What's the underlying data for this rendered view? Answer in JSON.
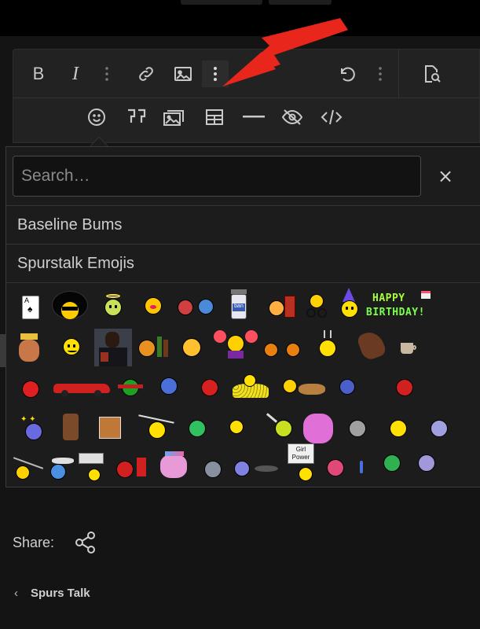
{
  "search": {
    "placeholder": "Search…"
  },
  "close_symbol": "×",
  "categories": [
    {
      "label": "Baseline Bums"
    },
    {
      "label": "Spurstalk Emojis"
    }
  ],
  "birthday_badge": {
    "line1": "HAPPY",
    "line2": "BIRTHDAY!"
  },
  "share": {
    "label": "Share:"
  },
  "breadcrumb": {
    "label": "Spurs Talk",
    "chevron": "‹"
  },
  "toolbar": {
    "row1_icons": [
      "bold-icon",
      "italic-icon",
      "more-vertical-icon",
      "link-icon",
      "image-icon",
      "more-vertical-icon",
      "undo-icon",
      "more-vertical-icon",
      "preview-icon"
    ],
    "row2_icons": [
      "smiley-icon",
      "quote-icon",
      "media-icon",
      "table-icon",
      "horizontal-rule-icon",
      "spoiler-icon",
      "code-icon"
    ]
  },
  "emoji_rows": [
    [
      "playing-card-ace",
      "afro-sunglasses",
      "halo-smiley",
      "blushing-smiley",
      "juggling-smileys",
      "bartender-smiley",
      "wall-smiley",
      "cyclist-smiley",
      "party-hat-smiley",
      "happy-birthday-banner"
    ],
    [
      "king-face",
      "grin-smiley",
      "man-with-cup-photo",
      "smiley-with-bottles",
      "blowing-smiley",
      "cheerleader-smiley",
      "two-smileys",
      "antenna-smiley",
      "hand-gesture",
      "coffee-cup"
    ],
    [
      "angry-red-smiley",
      "red-convertible-car",
      "devil-sunglasses",
      "blue-sad-smiley",
      "mad-red-smiley",
      "gold-coin-pile",
      "laughing-smileys",
      "blue-grumpy-smiley",
      "red-devil-face"
    ],
    [
      "stars-smiley",
      "domo-figure",
      "hand-card",
      "flapping-smiley",
      "green-smiley",
      "yellow-small-smiley",
      "knife-smiley",
      "pink-elephant",
      "grey-stressed-smiley",
      "yellow-laughing-smiley",
      "purple-dizzy-smiley"
    ],
    [
      "fishing-smiley",
      "blue-flyer-smiley",
      "sign-holder-smiley",
      "devil-finger-smiley",
      "pink-unicorn",
      "grey-sad-smiley",
      "purple-pac-smiley",
      "girl-power-sign",
      "pink-smiley",
      "blue-partial",
      "money-smiley",
      "purple-grumpy-smiley"
    ]
  ],
  "girl_power_text": "Girl Power",
  "colors": {
    "background": "#141414",
    "panel": "#222222",
    "popup": "#1c1c1c",
    "arrow": "#e8261c",
    "text": "#d6d6d6"
  }
}
